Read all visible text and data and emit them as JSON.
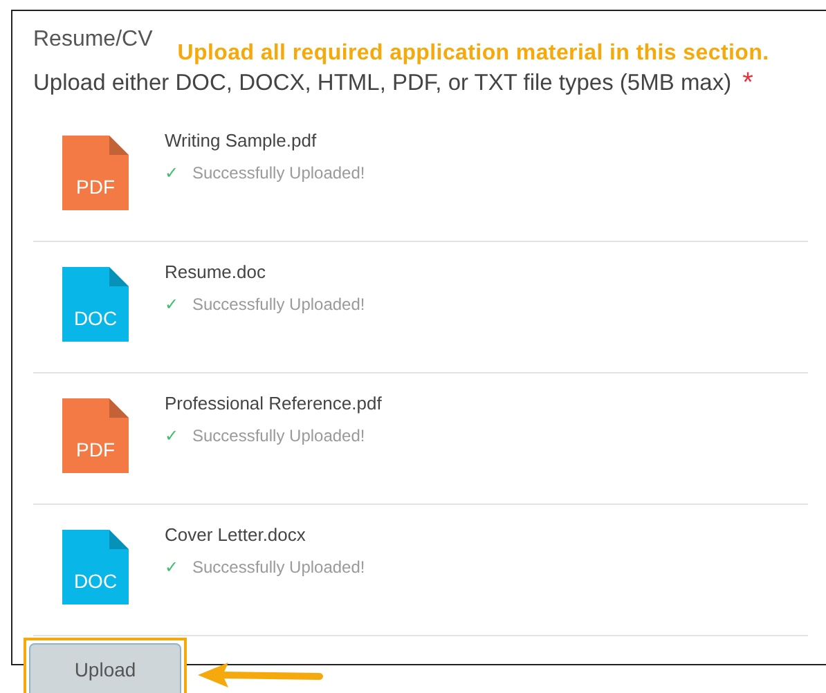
{
  "section_title": "Resume/CV",
  "annotation": "Upload all required application material in this section.",
  "instructions": "Upload either DOC, DOCX, HTML, PDF, or TXT file types (5MB max)",
  "required_mark": "*",
  "files": [
    {
      "icon_label": "PDF",
      "color": "#f47a45",
      "name": "Writing Sample.pdf",
      "check": "✓",
      "status": "Successfully Uploaded!"
    },
    {
      "icon_label": "DOC",
      "color": "#08b6e8",
      "name": "Resume.doc",
      "check": "✓",
      "status": "Successfully Uploaded!"
    },
    {
      "icon_label": "PDF",
      "color": "#f47a45",
      "name": "Professional Reference.pdf",
      "check": "✓",
      "status": "Successfully Uploaded!"
    },
    {
      "icon_label": "DOC",
      "color": "#08b6e8",
      "name": "Cover Letter.docx",
      "check": "✓",
      "status": "Successfully Uploaded!"
    }
  ],
  "upload_button": {
    "label": "Upload"
  }
}
